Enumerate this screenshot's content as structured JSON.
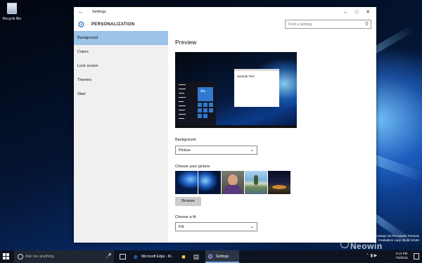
{
  "desktop": {
    "recycle_bin_label": "Recycle Bin",
    "watermark_line1": "Windows 10 Pro Insider Preview",
    "watermark_line2": "Evaluation copy. Build 10162",
    "brand": "Neowin"
  },
  "window": {
    "title": "Settings",
    "section": "PERSONALIZATION",
    "search_placeholder": "Find a setting"
  },
  "sidebar": {
    "items": [
      {
        "label": "Background"
      },
      {
        "label": "Colors"
      },
      {
        "label": "Lock screen"
      },
      {
        "label": "Themes"
      },
      {
        "label": "Start"
      }
    ],
    "active_index": 0
  },
  "main": {
    "preview_heading": "Preview",
    "preview_sample_text": "Sample Text",
    "preview_tile_text": "Aa",
    "background_label": "Background",
    "background_value": "Picture",
    "choose_picture_label": "Choose your picture",
    "browse_label": "Browse",
    "fit_label": "Choose a fit",
    "fit_value": "Fill"
  },
  "taskbar": {
    "search_placeholder": "Ask me anything",
    "apps": [
      {
        "label": "Microsoft Edge - M..."
      },
      {
        "label": "Settings"
      }
    ],
    "time": "3:13 PM",
    "date": "7/2/2015"
  },
  "colors": {
    "accent": "#1e6fb8",
    "nav_selected": "#9cc3e8",
    "taskbar": "#0d1420"
  }
}
